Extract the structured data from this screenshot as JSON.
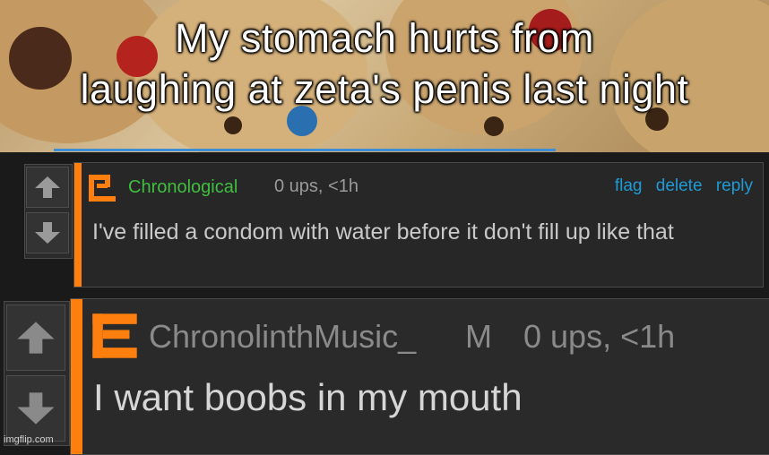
{
  "meme": {
    "caption_line1": "My stomach hurts from",
    "caption_line2": "laughing at zeta's penis last night"
  },
  "comments": [
    {
      "username": "Chronological",
      "meta": "0 ups, <1h",
      "actions": [
        "flag",
        "delete",
        "reply"
      ],
      "text": "I've filled a condom with water before it don't fill up like that"
    },
    {
      "username": "ChronolinthMusic_",
      "tag": "M",
      "meta": "0 ups, <1h",
      "text": "I want boobs in my mouth"
    }
  ],
  "watermark": "imgflip.com",
  "colors": {
    "accent_bar": "#ff7f0e",
    "username_green": "#3fbf3f",
    "action_blue": "#1e9bd7",
    "comment_bg": "#272727"
  },
  "icons": [
    "upvote-arrow-icon",
    "downvote-arrow-icon",
    "avatar-icon"
  ]
}
